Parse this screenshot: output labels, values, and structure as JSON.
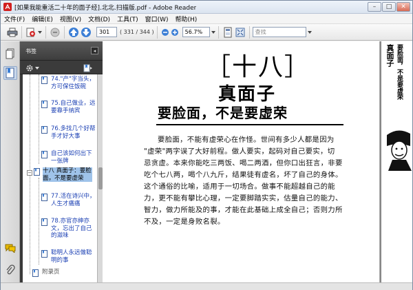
{
  "window": {
    "title": "[如果我能重活二十年的面子经].北北.扫描版.pdf - Adobe Reader",
    "controls": {
      "minimize": "–",
      "maximize": "□",
      "close": "✕"
    }
  },
  "menu": [
    "文件(F)",
    "编辑(E)",
    "视图(V)",
    "文档(D)",
    "工具(T)",
    "窗口(W)",
    "帮助(H)"
  ],
  "toolbar": {
    "page_number": "301",
    "page_count": "( 331 / 344 )",
    "zoom": "56.7%",
    "find_placeholder": "查找"
  },
  "bookmarks": {
    "title": "书签",
    "collapse": "◂",
    "items": [
      {
        "label": "74.\"产\"字当头，方可保住饭碗",
        "state": "normal"
      },
      {
        "label": "75.自己做业，远要靠手纳宾",
        "state": "normal"
      },
      {
        "label": "76.多找几个好帮手才好大事",
        "state": "normal"
      },
      {
        "label": "自己该如何出下一张牌",
        "state": "normal"
      },
      {
        "label": "十八 真面子：要脸面，不是要虚荣",
        "state": "selected"
      },
      {
        "label": "77.活在诗兴中，人生才痛痛",
        "state": "normal"
      },
      {
        "label": "78.亦官亦绅亦文，忘出了自己的滋味",
        "state": "normal"
      },
      {
        "label": "聪明人永远做聪明的事",
        "state": "normal"
      },
      {
        "label": "附录页",
        "state": "gray"
      }
    ]
  },
  "document": {
    "chapter_number": "［十八］",
    "chapter_title": "真面子",
    "subtitle": "要脸面，不是要虚荣",
    "paragraphs": [
      {
        "text": "要脸面，不能有虚荣心在作怪。世间有多少人都是因为",
        "indent": true
      },
      {
        "text": "\"虚荣\"两字误了大好前程。做人要实，起码对自己要实，切",
        "indent": false
      },
      {
        "text": "忌贪虚。本来你能吃三两饭、喝二两酒，但你口出狂言，非要",
        "indent": false
      },
      {
        "text": "吃个七八两，喝个八九斤，结果徒有虚名，坏了自己的身体。",
        "indent": false
      },
      {
        "text": "这个通俗的比喻，适用于一切场合。做事不能超越自己的能",
        "indent": false
      },
      {
        "text": "力，更不能有攀比心理，一定要脚踏实实，估量自己的能力、",
        "indent": false
      },
      {
        "text": "智力，做力所能及的事，才能在此基础上成全自己；否则力所",
        "indent": false
      },
      {
        "text": "不及，一定是身败名裂。",
        "indent": false
      }
    ]
  },
  "right_pane": {
    "column1": "真面子",
    "column2": "要脸面，不是要虚荣"
  }
}
